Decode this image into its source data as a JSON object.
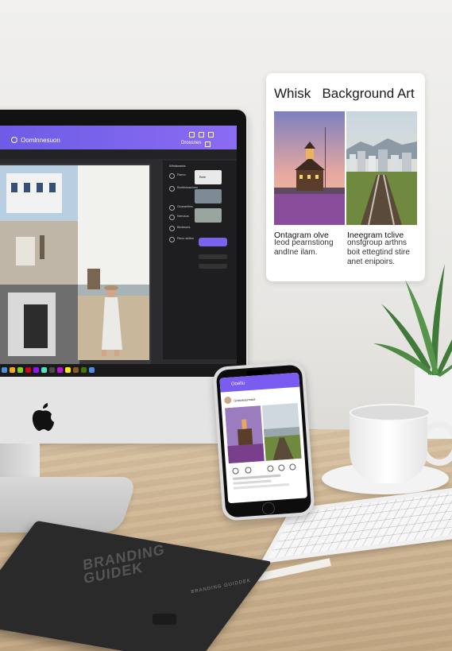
{
  "card": {
    "title": "Whisk   Background Art",
    "left_caption_title": "Ontagram olve",
    "left_caption_body": "Ieod pearnstiong\nandIne ilam.",
    "right_caption_title": "Ineegram tclive",
    "right_caption_body": "onsfgroup arthns\nboit ettegtind stire\nanet enipoirs."
  },
  "monitor": {
    "app_title": "Oomlnnesuon",
    "top_right_label": "Drossnes",
    "panel_items": [
      "Wlnldownts",
      "Ramo",
      "Bontiniaaciosn",
      "Guaranties",
      "Nmvaus",
      "Binitnoes",
      "Reoc stdlon"
    ],
    "thumb_label": "Bete"
  },
  "phone": {
    "app_bar_title": "Ooeliu",
    "user_name": "Gntrowsunnaor"
  },
  "notebook": {
    "title": "BRANDING\nGUIDEK",
    "subtitle": "BRANDING GUIDDEK"
  },
  "colors": {
    "accent": "#7a5cf0",
    "screen_dark": "#2c2c2e"
  }
}
